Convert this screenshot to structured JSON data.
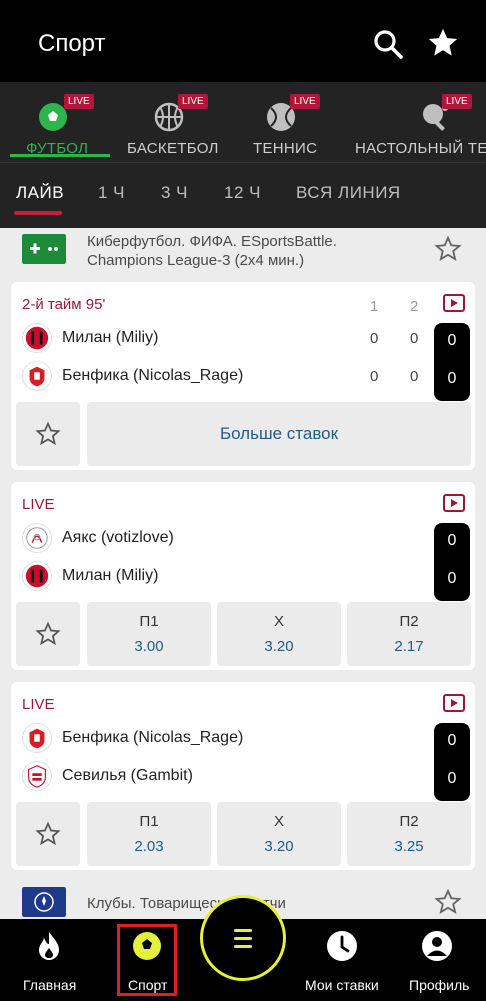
{
  "header": {
    "title": "Спорт"
  },
  "sports": [
    {
      "label": "ФУТБОЛ",
      "badge": "LIVE",
      "active": true
    },
    {
      "label": "БАСКЕТБОЛ",
      "badge": "LIVE"
    },
    {
      "label": "ТЕННИС",
      "badge": "LIVE"
    },
    {
      "label": "НАСТОЛЬНЫЙ ТЕННИС",
      "badge": "LIVE"
    }
  ],
  "time_filters": [
    "ЛАЙВ",
    "1 Ч",
    "3 Ч",
    "12 Ч",
    "ВСЯ ЛИНИЯ"
  ],
  "league1": {
    "line1": "Киберфутбол. ФИФА. ESportsBattle.",
    "line2": "Champions League-3 (2x4 мин.)"
  },
  "match1": {
    "status": "2-й тайм 95'",
    "col1": "1",
    "col2": "2",
    "home": {
      "name": "Милан (Miliy)",
      "s1": "0",
      "s2": "0",
      "total": "0"
    },
    "away": {
      "name": "Бенфика (Nicolas_Rage)",
      "s1": "0",
      "s2": "0",
      "total": "0"
    },
    "more_label": "Больше ставок"
  },
  "match2": {
    "status": "LIVE",
    "home": {
      "name": "Аякс (votizlove)",
      "total": "0"
    },
    "away": {
      "name": "Милан (Miliy)",
      "total": "0"
    },
    "odds": [
      {
        "k": "П1",
        "v": "3.00"
      },
      {
        "k": "X",
        "v": "3.20"
      },
      {
        "k": "П2",
        "v": "2.17"
      }
    ]
  },
  "match3": {
    "status": "LIVE",
    "home": {
      "name": "Бенфика (Nicolas_Rage)",
      "total": "0"
    },
    "away": {
      "name": "Севилья (Gambit)",
      "total": "0"
    },
    "odds": [
      {
        "k": "П1",
        "v": "2.03"
      },
      {
        "k": "X",
        "v": "3.20"
      },
      {
        "k": "П2",
        "v": "3.25"
      }
    ]
  },
  "league2": {
    "line1": "Клубы. Товарищеские матчи"
  },
  "bottom_nav": {
    "home": "Главная",
    "sport": "Спорт",
    "my_bets": "Мои ставки",
    "profile": "Профиль"
  },
  "colors": {
    "accent_green": "#2fb34d",
    "live_red": "#b1173a",
    "odds_blue": "#1f5c86",
    "center_yellow": "#e6f03a"
  }
}
